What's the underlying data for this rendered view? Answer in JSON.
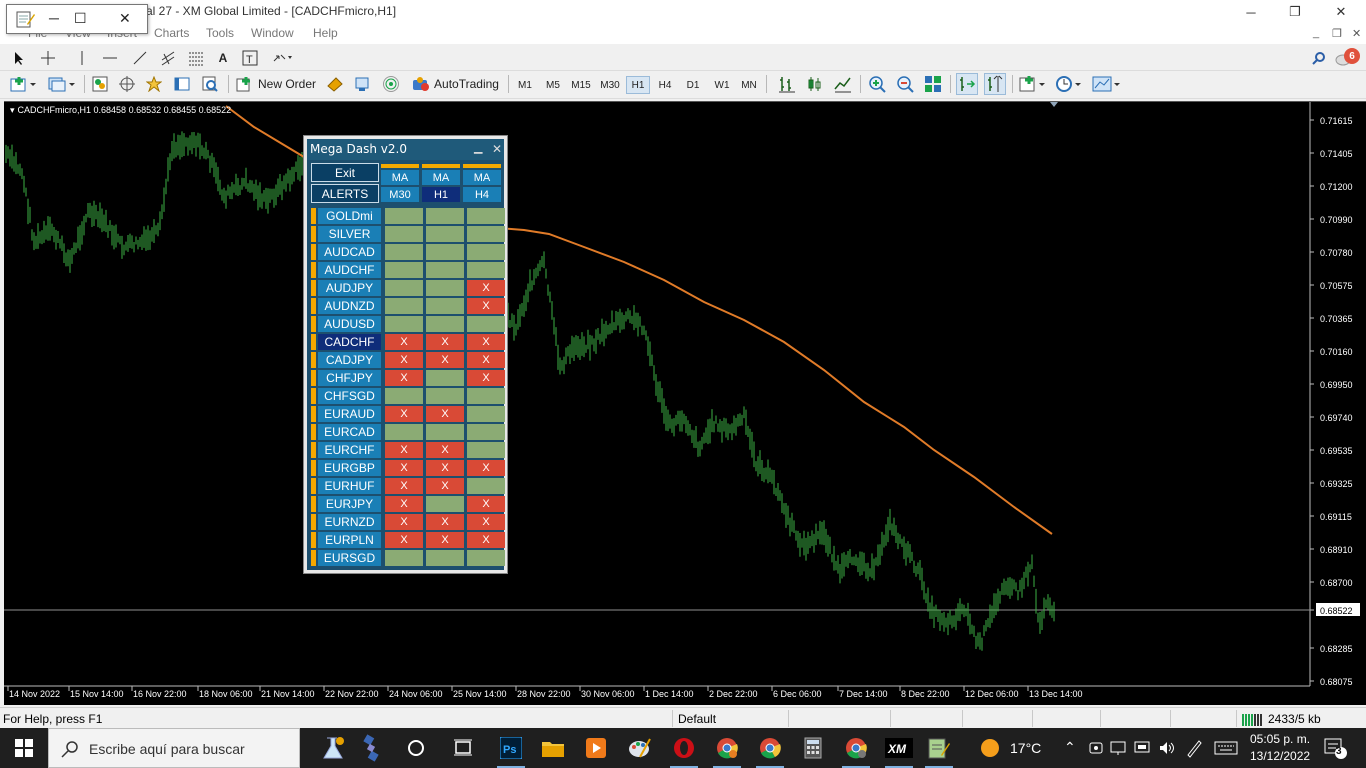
{
  "window": {
    "title": "al 27 - XM Global Limited - [CADCHFmicro,H1]",
    "controls": {
      "minimize": "─",
      "restore": "❐",
      "close": "✕"
    }
  },
  "float_window": {
    "minimize": "─",
    "maximize": "☐",
    "close": "✕"
  },
  "menu": {
    "items": [
      "File",
      "View",
      "Insert",
      "Charts",
      "Tools",
      "Window",
      "Help"
    ],
    "mdi": {
      "minimize": "_",
      "restore": "❐",
      "close": "✕"
    }
  },
  "toolbar": {
    "new_order": "New Order",
    "autotrading": "AutoTrading",
    "timeframes": [
      "M1",
      "M5",
      "M15",
      "M30",
      "H1",
      "H4",
      "D1",
      "W1",
      "MN"
    ],
    "active_timeframe": "H1",
    "notifications_count": "6"
  },
  "chart": {
    "label": "CADCHFmicro,H1  0.68458 0.68532 0.68455 0.68522",
    "current_price": "0.68522",
    "price_ticks": [
      "0.71615",
      "0.71405",
      "0.71200",
      "0.70990",
      "0.70780",
      "0.70575",
      "0.70365",
      "0.70160",
      "0.69950",
      "0.69740",
      "0.69535",
      "0.69325",
      "0.69115",
      "0.68910",
      "0.68700",
      "0.68522",
      "0.68285",
      "0.68075"
    ],
    "time_ticks": [
      "14 Nov 2022",
      "15 Nov 14:00",
      "16 Nov 22:00",
      "18 Nov 06:00",
      "21 Nov 14:00",
      "22 Nov 22:00",
      "24 Nov 06:00",
      "25 Nov 14:00",
      "28 Nov 22:00",
      "30 Nov 06:00",
      "1 Dec 14:00",
      "2 Dec 22:00",
      "6 Dec 06:00",
      "7 Dec 14:00",
      "8 Dec 22:00",
      "12 Dec 06:00",
      "13 Dec 14:00"
    ],
    "colors": {
      "bars": "#3cb043",
      "ma": "#e07b28",
      "background": "#000000"
    }
  },
  "dashboard": {
    "title": "Mega Dash v2.0",
    "minimize": "▁",
    "close": "✕",
    "exit_label": "Exit",
    "alerts_label": "ALERTS",
    "columns": [
      {
        "indicator": "MA",
        "timeframe": "M30"
      },
      {
        "indicator": "MA",
        "timeframe": "H1"
      },
      {
        "indicator": "MA",
        "timeframe": "H4"
      }
    ],
    "current_timeframe": "H1",
    "current_symbol": "CADCHF",
    "rows": [
      {
        "symbol": "GOLDmi",
        "cells": [
          "",
          "",
          ""
        ]
      },
      {
        "symbol": "SILVER",
        "cells": [
          "",
          "",
          ""
        ]
      },
      {
        "symbol": "AUDCAD",
        "cells": [
          "",
          "",
          ""
        ]
      },
      {
        "symbol": "AUDCHF",
        "cells": [
          "",
          "",
          ""
        ]
      },
      {
        "symbol": "AUDJPY",
        "cells": [
          "",
          "",
          "X"
        ]
      },
      {
        "symbol": "AUDNZD",
        "cells": [
          "",
          "",
          "X"
        ]
      },
      {
        "symbol": "AUDUSD",
        "cells": [
          "",
          "",
          ""
        ]
      },
      {
        "symbol": "CADCHF",
        "cells": [
          "X",
          "X",
          "X"
        ]
      },
      {
        "symbol": "CADJPY",
        "cells": [
          "X",
          "X",
          "X"
        ]
      },
      {
        "symbol": "CHFJPY",
        "cells": [
          "X",
          "",
          "X"
        ]
      },
      {
        "symbol": "CHFSGD",
        "cells": [
          "",
          "",
          ""
        ]
      },
      {
        "symbol": "EURAUD",
        "cells": [
          "X",
          "X",
          ""
        ]
      },
      {
        "symbol": "EURCAD",
        "cells": [
          "",
          "",
          ""
        ]
      },
      {
        "symbol": "EURCHF",
        "cells": [
          "X",
          "X",
          ""
        ]
      },
      {
        "symbol": "EURGBP",
        "cells": [
          "X",
          "X",
          "X"
        ]
      },
      {
        "symbol": "EURHUF",
        "cells": [
          "X",
          "X",
          ""
        ]
      },
      {
        "symbol": "EURJPY",
        "cells": [
          "X",
          "",
          "X"
        ]
      },
      {
        "symbol": "EURNZD",
        "cells": [
          "X",
          "X",
          "X"
        ]
      },
      {
        "symbol": "EURPLN",
        "cells": [
          "X",
          "X",
          "X"
        ]
      },
      {
        "symbol": "EURSGD",
        "cells": [
          "",
          "",
          ""
        ]
      }
    ],
    "colors": {
      "ok": "#8bab74",
      "alert": "#d94a36",
      "symbol": "#1a7fb6",
      "accent": "#f5a800"
    }
  },
  "statusbar": {
    "help": "For Help, press F1",
    "profile": "Default",
    "traffic": "2433/5 kb"
  },
  "taskbar": {
    "search_placeholder": "Escribe aquí para buscar",
    "temperature": "17°C",
    "time": "05:05 p. m.",
    "date": "13/12/2022",
    "notifications": "3"
  }
}
